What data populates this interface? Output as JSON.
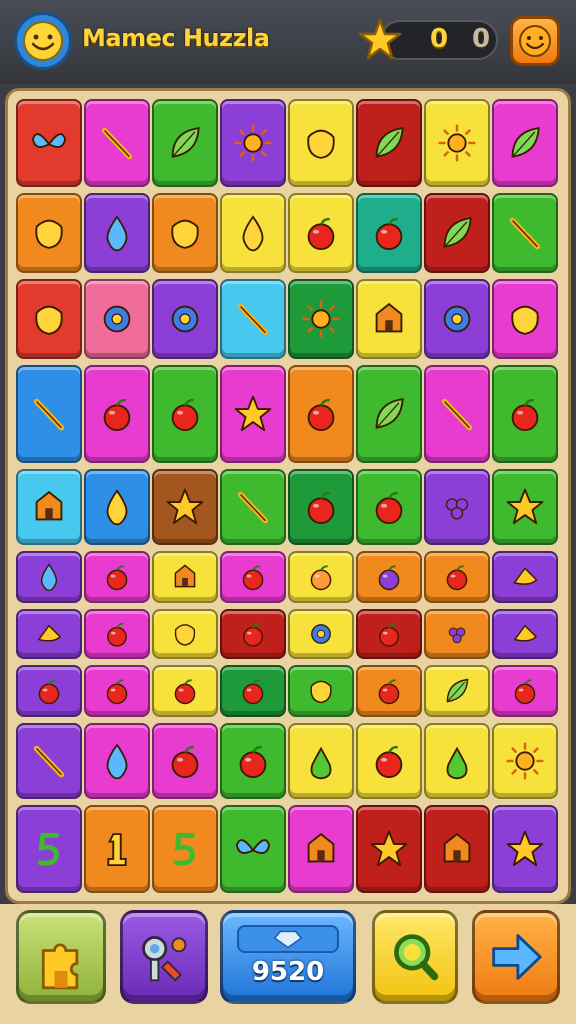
{
  "header": {
    "title": "Mamec Huzzla",
    "score_primary": "0",
    "score_secondary": "0"
  },
  "colors": {
    "red": "#e23b2e",
    "magenta": "#e83bcf",
    "green": "#3fba2f",
    "purple": "#8b3fd6",
    "yellow": "#f7e23c",
    "darkred": "#c0201c",
    "orange": "#f08a1e",
    "blue": "#2e8fe6",
    "pink": "#f06c9a",
    "cyan": "#47c8ee",
    "teal": "#1fae8c",
    "brown": "#a3571e",
    "darkgreen": "#1f9a3a"
  },
  "board": {
    "rows": [
      [
        "red:bird-icon",
        "magenta:paintbrush-icon",
        "green:leaf-icon",
        "purple:sun-icon",
        "yellow:mushroom-character-icon",
        "darkred:feather-icon",
        "yellow:sun-icon",
        "magenta:blue-leaf-icon"
      ],
      [
        "orange:shell-icon",
        "purple:blue-drop-icon",
        "orange:pin-icon",
        "yellow:drop-icon",
        "yellow:apple-icon",
        "teal:apple-icon",
        "darkred:leaf-icon",
        "green:wand-icon"
      ],
      [
        "red:knot-icon",
        "pink:compass-icon",
        "purple:gear-icon",
        "cyan:key-icon",
        "darkgreen:sun-face-icon",
        "yellow:lantern-icon",
        "purple:ball-icon",
        "magenta:triangle-icon"
      ],
      [
        "blue:quill-icon",
        "magenta:apple-stack-icon",
        "green:strawberry-star-icon",
        "magenta:star-hand-icon",
        "orange:heart-berry-icon",
        "green:leaf-basket-icon",
        "magenta:tongs-icon",
        "green:apple-basket-icon"
      ],
      [
        "cyan:z-block-icon",
        "blue:lemon-icon",
        "brown:star-icon",
        "green:crystal-icon",
        "darkgreen:apple-icon",
        "green:tomato-icon",
        "purple:berries-icon",
        "green:star-icon"
      ],
      [
        "purple:egg-icon",
        "magenta:apple-icon",
        "yellow:bell-icon",
        "magenta:apple-icon",
        "yellow:peach-icon",
        "orange:plum-icon",
        "orange:apple-icon",
        "purple:flower-icon"
      ],
      [
        "purple:cheese-icon",
        "magenta:apple-icon",
        "yellow:pepper-icon",
        "darkred:apple-icon",
        "yellow:ball-icon",
        "darkred:apple-icon",
        "orange:grapes-icon",
        "purple:cheese-icon"
      ],
      [
        "purple:apple-icon",
        "magenta:apple-icon",
        "yellow:apple-icon",
        "darkgreen:apple-icon",
        "green:flag-icon",
        "orange:apple-icon",
        "yellow:leaf-icon",
        "magenta:apple-icon"
      ],
      [
        "purple:bones-icon",
        "magenta:egg-icon",
        "magenta:apple-icon",
        "green:apple-icon",
        "yellow:pear-icon",
        "yellow:apple-icon",
        "yellow:pear-icon",
        "yellow:sun-icon"
      ],
      [
        "purple:hook-icon",
        "orange:number-one-icon",
        "orange:number-five-icon",
        "green:butterfly-icon",
        "magenta:lantern-box-icon",
        "darkred:star-icon",
        "darkred:house-icon",
        "purple:star-hand-icon"
      ]
    ]
  },
  "bottom_bar": {
    "coins_label": "9520"
  }
}
